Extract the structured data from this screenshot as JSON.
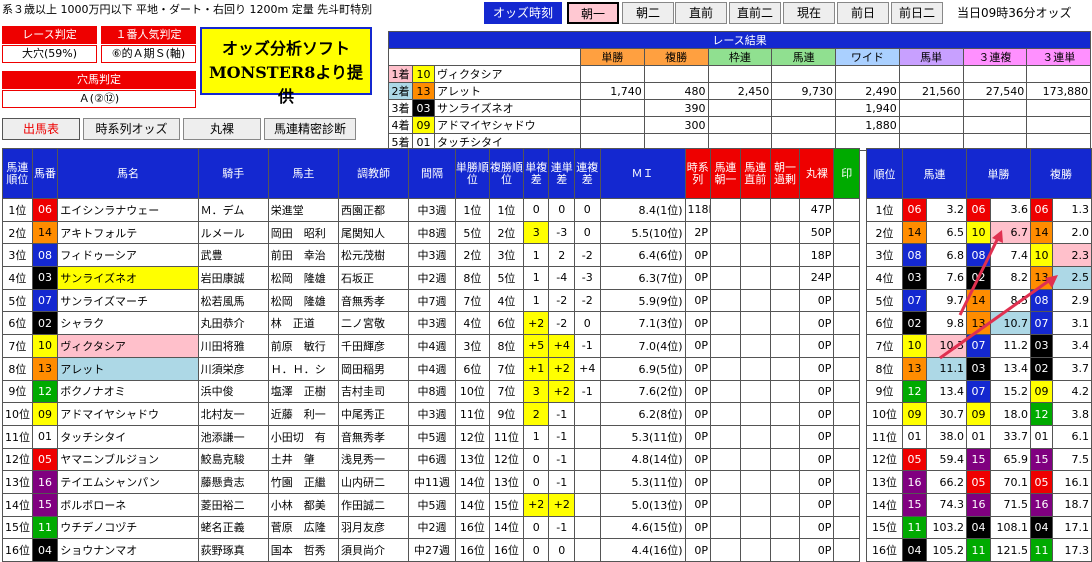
{
  "race_header": "系３歳以上 1000万円以下 平地・ダート・右回り 1200m 定量 先斗町特別",
  "odds_label": "オッズ時刻",
  "time_buttons": [
    {
      "label": "朝一",
      "active": true
    },
    {
      "label": "朝二"
    },
    {
      "label": "直前"
    },
    {
      "label": "直前二"
    },
    {
      "label": "現在"
    },
    {
      "label": "前日"
    },
    {
      "label": "前日二"
    }
  ],
  "clock": "当日09時36分オッズ",
  "race_judge": {
    "label": "レース判定",
    "value": "大穴(59%)"
  },
  "fav_judge": {
    "label": "１番人気判定",
    "value": "⑥的Ａ期Ｓ(軸)"
  },
  "dark_judge": {
    "label": "穴馬判定",
    "value": "Ａ(②⑫)"
  },
  "ad": {
    "line1": "オッズ分析ソフト",
    "line2": "MONSTER8より提供"
  },
  "nav": [
    {
      "label": "出馬表",
      "active": true
    },
    {
      "label": "時系列オッズ"
    },
    {
      "label": "丸裸"
    },
    {
      "label": "馬連精密診断"
    }
  ],
  "result": {
    "title": "レース結果",
    "headers": [
      "単勝",
      "複勝",
      "枠連",
      "馬連",
      "ワイド",
      "馬単",
      "３連複",
      "３連単"
    ],
    "header_colors": [
      "#ffa040",
      "#ffa040",
      "#90e090",
      "#90e090",
      "#aad0ff",
      "#c8a0ff",
      "#ff90ff",
      "#ff90ff"
    ],
    "rows": [
      {
        "pos": "1着",
        "num": "10",
        "name": "ヴィクタシア",
        "vals": [
          "",
          "",
          "",
          "",
          "",
          "",
          "",
          ""
        ]
      },
      {
        "pos": "2着",
        "num": "13",
        "name": "アレット",
        "vals": [
          "1,740",
          "480",
          "2,450",
          "9,730",
          "2,490",
          "21,560",
          "27,540",
          "173,880"
        ]
      },
      {
        "pos": "3着",
        "num": "03",
        "name": "サンライズネオ",
        "vals": [
          "",
          "390",
          "",
          "",
          "1,940",
          "",
          "",
          ""
        ]
      },
      {
        "pos": "4着",
        "num": "09",
        "name": "アドマイヤシャドウ",
        "vals": [
          "",
          "300",
          "",
          "",
          "1,880",
          "",
          "",
          ""
        ]
      },
      {
        "pos": "5着",
        "num": "01",
        "name": "タッチシタイ",
        "vals": [
          "",
          "",
          "",
          "",
          "",
          "",
          "",
          ""
        ]
      }
    ]
  },
  "main": {
    "headers": [
      "馬連順位",
      "馬番",
      "馬名",
      "騎手",
      "馬主",
      "調教師",
      "間隔",
      "単勝順位",
      "複勝順位",
      "単複差",
      "連単差",
      "連複差",
      "ＭＩ",
      "時系列",
      "馬連朝一",
      "馬連直前",
      "朝一過剰",
      "丸裸",
      "印"
    ],
    "rows": [
      {
        "rank": "1位",
        "num": "06",
        "name": "エイシンラナウェー",
        "jockey": "Ｍ．デム",
        "owner": "栄進堂",
        "trainer": "西園正都",
        "gap": "中3週",
        "win": "1位",
        "place": "1位",
        "d1": "0",
        "d2": "0",
        "d3": "0",
        "mi": "8.4(1位)",
        "ts": "118P",
        "bare": "47P"
      },
      {
        "rank": "2位",
        "num": "14",
        "name": "アキトフォルテ",
        "jockey": "ルメール",
        "owner": "岡田　昭利",
        "trainer": "尾関知人",
        "gap": "中8週",
        "win": "5位",
        "place": "2位",
        "d1": "3",
        "d2": "-3",
        "d3": "0",
        "mi": "5.5(10位)",
        "ts": "2P",
        "bare": "50P"
      },
      {
        "rank": "3位",
        "num": "08",
        "name": "フィドゥーシア",
        "jockey": "武豊",
        "owner": "前田　幸治",
        "trainer": "松元茂樹",
        "gap": "中3週",
        "win": "2位",
        "place": "3位",
        "d1": "1",
        "d2": "2",
        "d3": "-2",
        "mi": "6.4(6位)",
        "ts": "0P",
        "bare": "18P"
      },
      {
        "rank": "4位",
        "num": "03",
        "name": "サンライズネオ",
        "jockey": "岩田康誠",
        "owner": "松岡　隆雄",
        "trainer": "石坂正",
        "gap": "中2週",
        "win": "8位",
        "place": "5位",
        "d1": "1",
        "d2": "-4",
        "d3": "-3",
        "mi": "6.3(7位)",
        "ts": "0P",
        "bare": "24P"
      },
      {
        "rank": "5位",
        "num": "07",
        "name": "サンライズマーチ",
        "jockey": "松若風馬",
        "owner": "松岡　隆雄",
        "trainer": "音無秀孝",
        "gap": "中7週",
        "win": "7位",
        "place": "4位",
        "d1": "1",
        "d2": "-2",
        "d3": "-2",
        "mi": "5.9(9位)",
        "ts": "0P",
        "bare": "0P"
      },
      {
        "rank": "6位",
        "num": "02",
        "name": "シャラク",
        "jockey": "丸田恭介",
        "owner": "林　正道",
        "trainer": "二ノ宮敬",
        "gap": "中3週",
        "win": "4位",
        "place": "6位",
        "d1": "+2",
        "d2": "-2",
        "d3": "0",
        "mi": "7.1(3位)",
        "ts": "0P",
        "bare": "0P"
      },
      {
        "rank": "7位",
        "num": "10",
        "name": "ヴィクタシア",
        "jockey": "川田将雅",
        "owner": "前原　敏行",
        "trainer": "千田輝彦",
        "gap": "中4週",
        "win": "3位",
        "place": "8位",
        "d1": "+5",
        "d2": "+4",
        "d3": "-1",
        "mi": "7.0(4位)",
        "ts": "0P",
        "bare": "0P"
      },
      {
        "rank": "8位",
        "num": "13",
        "name": "アレット",
        "jockey": "川須栄彦",
        "owner": "Ｈ．Ｈ．シ",
        "trainer": "岡田稲男",
        "gap": "中4週",
        "win": "6位",
        "place": "7位",
        "d1": "+1",
        "d2": "+2",
        "d3": "+4",
        "mi": "6.9(5位)",
        "ts": "0P",
        "bare": "0P"
      },
      {
        "rank": "9位",
        "num": "12",
        "name": "ボクノナオミ",
        "jockey": "浜中俊",
        "owner": "塩澤　正樹",
        "trainer": "吉村圭司",
        "gap": "中8週",
        "win": "10位",
        "place": "7位",
        "d1": "3",
        "d2": "+2",
        "d3": "-1",
        "mi": "7.6(2位)",
        "ts": "0P",
        "bare": "0P"
      },
      {
        "rank": "10位",
        "num": "09",
        "name": "アドマイヤシャドウ",
        "jockey": "北村友一",
        "owner": "近藤　利一",
        "trainer": "中尾秀正",
        "gap": "中3週",
        "win": "11位",
        "place": "9位",
        "d1": "2",
        "d2": "-1",
        "d3": "",
        "mi": "6.2(8位)",
        "ts": "0P",
        "bare": "0P"
      },
      {
        "rank": "11位",
        "num": "01",
        "name": "タッチシタイ",
        "jockey": "池添謙一",
        "owner": "小田切　有",
        "trainer": "音無秀孝",
        "gap": "中5週",
        "win": "12位",
        "place": "11位",
        "d1": "1",
        "d2": "-1",
        "d3": "",
        "mi": "5.3(11位)",
        "ts": "0P",
        "bare": "0P"
      },
      {
        "rank": "12位",
        "num": "05",
        "name": "ヤマニンブルジョン",
        "jockey": "鮫島克駿",
        "owner": "土井　肇",
        "trainer": "浅見秀一",
        "gap": "中6週",
        "win": "13位",
        "place": "12位",
        "d1": "0",
        "d2": "-1",
        "d3": "",
        "mi": "4.8(14位)",
        "ts": "0P",
        "bare": "0P"
      },
      {
        "rank": "13位",
        "num": "16",
        "name": "テイエムシャンパン",
        "jockey": "藤懸貴志",
        "owner": "竹園　正繼",
        "trainer": "山内研二",
        "gap": "中11週",
        "win": "14位",
        "place": "13位",
        "d1": "0",
        "d2": "-1",
        "d3": "",
        "mi": "5.3(11位)",
        "ts": "0P",
        "bare": "0P"
      },
      {
        "rank": "14位",
        "num": "15",
        "name": "ボルボローネ",
        "jockey": "菱田裕二",
        "owner": "小林　都美",
        "trainer": "作田誠二",
        "gap": "中5週",
        "win": "14位",
        "place": "15位",
        "d1": "+2",
        "d2": "+2",
        "d3": "",
        "mi": "5.0(13位)",
        "ts": "0P",
        "bare": "0P"
      },
      {
        "rank": "15位",
        "num": "11",
        "name": "ウチデノコヅチ",
        "jockey": "蛯名正義",
        "owner": "菅原　広隆",
        "trainer": "羽月友彦",
        "gap": "中2週",
        "win": "16位",
        "place": "14位",
        "d1": "0",
        "d2": "-1",
        "d3": "",
        "mi": "4.6(15位)",
        "ts": "0P",
        "bare": "0P"
      },
      {
        "rank": "16位",
        "num": "04",
        "name": "ショウナンマオ",
        "jockey": "荻野琢真",
        "owner": "国本　哲秀",
        "trainer": "須貝尚介",
        "gap": "中27週",
        "win": "16位",
        "place": "16位",
        "d1": "0",
        "d2": "0",
        "d3": "",
        "mi": "4.4(16位)",
        "ts": "0P",
        "bare": "0P"
      }
    ]
  },
  "side": {
    "headers": [
      "順位",
      "馬連",
      "単勝",
      "複勝"
    ],
    "rows": [
      {
        "rank": "1位",
        "q": "06",
        "qv": "3.2",
        "w": "06",
        "wv": "3.6",
        "p": "06",
        "pv": "1.3"
      },
      {
        "rank": "2位",
        "q": "14",
        "qv": "6.5",
        "w": "10",
        "wv": "6.7",
        "p": "14",
        "pv": "2.0"
      },
      {
        "rank": "3位",
        "q": "08",
        "qv": "6.8",
        "w": "08",
        "wv": "7.4",
        "p": "10",
        "pv": "2.3"
      },
      {
        "rank": "4位",
        "q": "03",
        "qv": "7.6",
        "w": "02",
        "wv": "8.2",
        "p": "13",
        "pv": "2.5"
      },
      {
        "rank": "5位",
        "q": "07",
        "qv": "9.7",
        "w": "14",
        "wv": "8.5",
        "p": "08",
        "pv": "2.9"
      },
      {
        "rank": "6位",
        "q": "02",
        "qv": "9.8",
        "w": "13",
        "wv": "10.7",
        "p": "07",
        "pv": "3.1"
      },
      {
        "rank": "7位",
        "q": "10",
        "qv": "10.3",
        "w": "07",
        "wv": "11.2",
        "p": "03",
        "pv": "3.4"
      },
      {
        "rank": "8位",
        "q": "13",
        "qv": "11.1",
        "w": "03",
        "wv": "13.4",
        "p": "02",
        "pv": "3.7"
      },
      {
        "rank": "9位",
        "q": "12",
        "qv": "13.4",
        "w": "07",
        "wv": "15.2",
        "p": "09",
        "pv": "4.2"
      },
      {
        "rank": "10位",
        "q": "09",
        "qv": "30.7",
        "w": "09",
        "wv": "18.0",
        "p": "12",
        "pv": "3.8"
      },
      {
        "rank": "11位",
        "q": "01",
        "qv": "38.0",
        "w": "01",
        "wv": "33.7",
        "p": "01",
        "pv": "6.1"
      },
      {
        "rank": "12位",
        "q": "05",
        "qv": "59.4",
        "w": "15",
        "wv": "65.9",
        "p": "15",
        "pv": "7.5"
      },
      {
        "rank": "13位",
        "q": "16",
        "qv": "66.2",
        "w": "05",
        "wv": "70.1",
        "p": "05",
        "pv": "16.1"
      },
      {
        "rank": "14位",
        "q": "15",
        "qv": "74.3",
        "w": "16",
        "wv": "71.5",
        "p": "16",
        "pv": "18.7"
      },
      {
        "rank": "15位",
        "q": "11",
        "qv": "103.2",
        "w": "04",
        "wv": "108.1",
        "p": "04",
        "pv": "17.1"
      },
      {
        "rank": "16位",
        "q": "04",
        "qv": "105.2",
        "w": "11",
        "wv": "121.5",
        "p": "11",
        "pv": "17.3"
      }
    ]
  },
  "num_colors": {
    "01": [
      "#fff",
      "#000"
    ],
    "02": [
      "#000",
      "#fff"
    ],
    "03": [
      "#000",
      "#fff"
    ],
    "04": [
      "#000",
      "#fff"
    ],
    "05": [
      "#e00",
      "#fff"
    ],
    "06": [
      "#e00",
      "#fff"
    ],
    "07": [
      "#1428d0",
      "#fff"
    ],
    "08": [
      "#1428d0",
      "#fff"
    ],
    "09": [
      "#ff0",
      "#000"
    ],
    "10": [
      "#ff0",
      "#000"
    ],
    "11": [
      "#0a0",
      "#fff"
    ],
    "12": [
      "#0a0",
      "#fff"
    ],
    "13": [
      "#ff8c00",
      "#000"
    ],
    "14": [
      "#ff8c00",
      "#000"
    ],
    "15": [
      "#800080",
      "#fff"
    ],
    "16": [
      "#800080",
      "#fff"
    ]
  }
}
